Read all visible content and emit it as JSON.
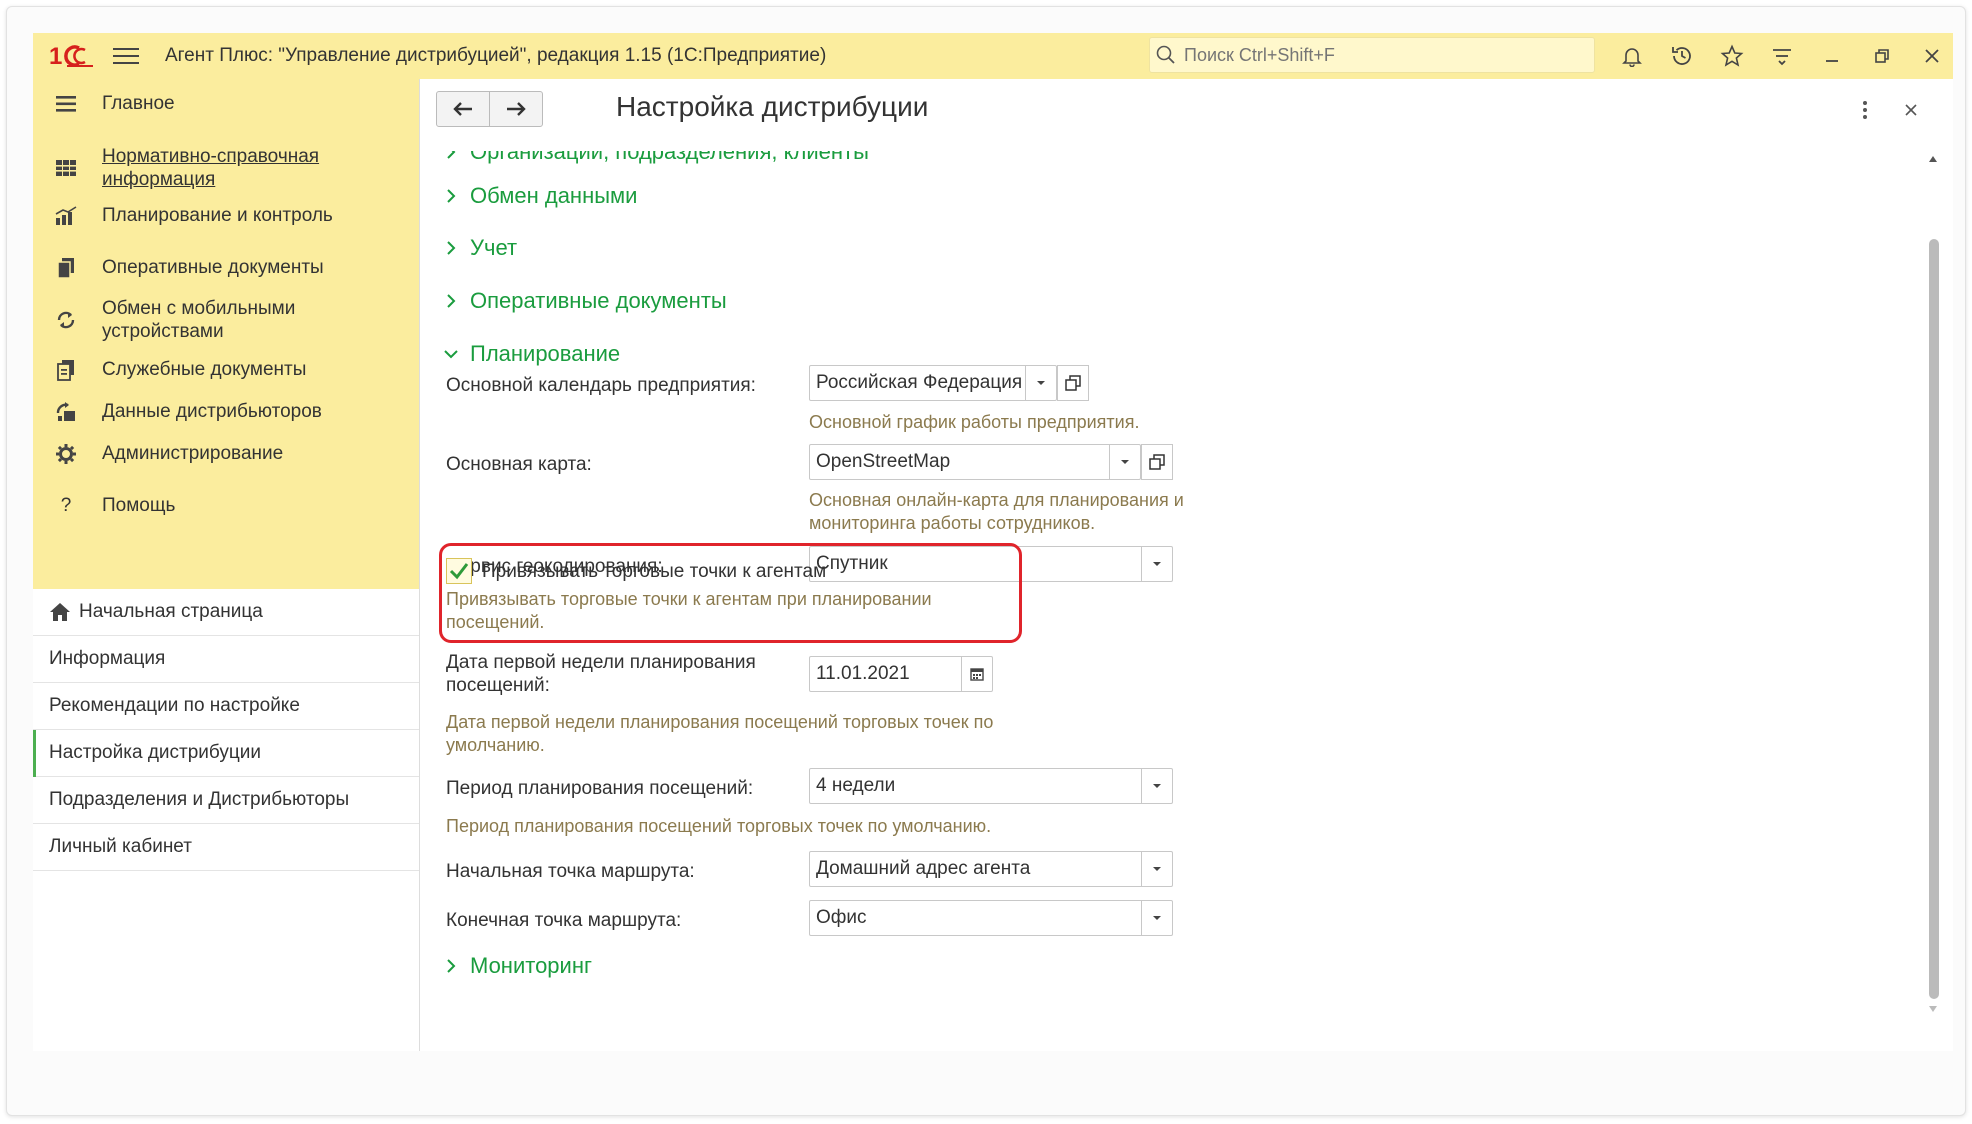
{
  "titlebar": {
    "app_title": "Агент Плюс: \"Управление дистрибуцией\", редакция 1.15  (1С:Предприятие)",
    "search_placeholder": "Поиск Ctrl+Shift+F",
    "icons": [
      "logo-1c-icon",
      "menu-icon",
      "bell-icon",
      "history-icon",
      "star-icon",
      "funnel-icon",
      "minimize-icon",
      "restore-icon",
      "close-icon"
    ]
  },
  "sidebar": {
    "sections": [
      {
        "label": "Главное",
        "icon": "menu-lines-icon"
      },
      {
        "label": "Нормативно-справочная информация",
        "icon": "catalog-grid-icon"
      },
      {
        "label": "Планирование и контроль",
        "icon": "chart-icon"
      },
      {
        "label": "Оперативные документы",
        "icon": "documents-icon"
      },
      {
        "label": "Обмен с мобильными устройствами",
        "icon": "sync-icon"
      },
      {
        "label": "Служебные документы",
        "icon": "service-docs-icon"
      },
      {
        "label": "Данные дистрибьюторов",
        "icon": "distributor-icon"
      },
      {
        "label": "Администрирование",
        "icon": "gear-icon"
      },
      {
        "label": "Помощь",
        "icon": "question-icon"
      }
    ],
    "open_windows": [
      {
        "label": "Начальная страница",
        "icon": "home-icon"
      },
      {
        "label": "Информация"
      },
      {
        "label": "Рекомендации по настройке"
      },
      {
        "label": "Настройка дистрибуции",
        "active": true
      },
      {
        "label": "Подразделения и Дистрибьюторы"
      },
      {
        "label": "Личный кабинет"
      }
    ]
  },
  "form": {
    "title": "Настройка дистрибуции",
    "groups": {
      "org": "Организации, подразделения, клиенты",
      "exchange": "Обмен данными",
      "accounting": "Учет",
      "operational": "Оперативные документы",
      "planning": "Планирование",
      "monitoring": "Мониторинг"
    },
    "planning": {
      "calendar_label": "Основной календарь предприятия:",
      "calendar_value": "Российская Федерация",
      "calendar_hint": "Основной график работы предприятия.",
      "map_label": "Основная карта:",
      "map_value": "OpenStreetMap",
      "map_hint_1": "Основная онлайн-карта для планирования и",
      "map_hint_2": "мониторинга работы сотрудников.",
      "geocoding_label": "Сервис геокодирования:",
      "geocoding_value": "Спутник",
      "bind_label": "Привязывать торговые точки к агентам",
      "bind_checked": true,
      "bind_hint_1": "Привязывать торговые точки к агентам при планировании",
      "bind_hint_2": "посещений.",
      "first_week_label_1": "Дата первой недели планирования",
      "first_week_label_2": "посещений:",
      "first_week_value": "11.01.2021",
      "first_week_hint_1": "Дата первой недели планирования посещений торговых точек по",
      "first_week_hint_2": "умолчанию.",
      "period_label": "Период планирования посещений:",
      "period_value": "4 недели",
      "period_hint": "Период планирования посещений торговых точек по умолчанию.",
      "start_point_label": "Начальная точка маршрута:",
      "start_point_value": "Домашний адрес агента",
      "end_point_label": "Конечная точка маршрута:",
      "end_point_value": "Офис"
    }
  },
  "colors": {
    "titlebar_bg": "#fbed9e",
    "group_title": "#1a9c3e",
    "hint_text": "#8b7a4e",
    "highlight_border": "#e0242b",
    "logo_red": "#d6201c"
  }
}
